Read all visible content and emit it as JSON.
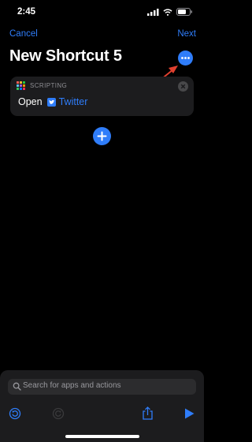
{
  "status_bar": {
    "time": "2:45"
  },
  "nav": {
    "cancel_label": "Cancel",
    "next_label": "Next"
  },
  "title": "New Shortcut 5",
  "action": {
    "category": "SCRIPTING",
    "verb": "Open",
    "app": "Twitter"
  },
  "search": {
    "placeholder": "Search for apps and actions"
  },
  "colors": {
    "accent": "#2f7dfa",
    "background": "#000000",
    "card": "#1c1c1e",
    "annotation_arrow": "#e0402f"
  },
  "icons": [
    "signal-icon",
    "wifi-icon",
    "battery-icon",
    "more-icon",
    "scripting-icon",
    "close-icon",
    "twitter-icon",
    "plus-icon",
    "search-icon",
    "undo-icon",
    "redo-icon",
    "share-icon",
    "play-icon"
  ]
}
